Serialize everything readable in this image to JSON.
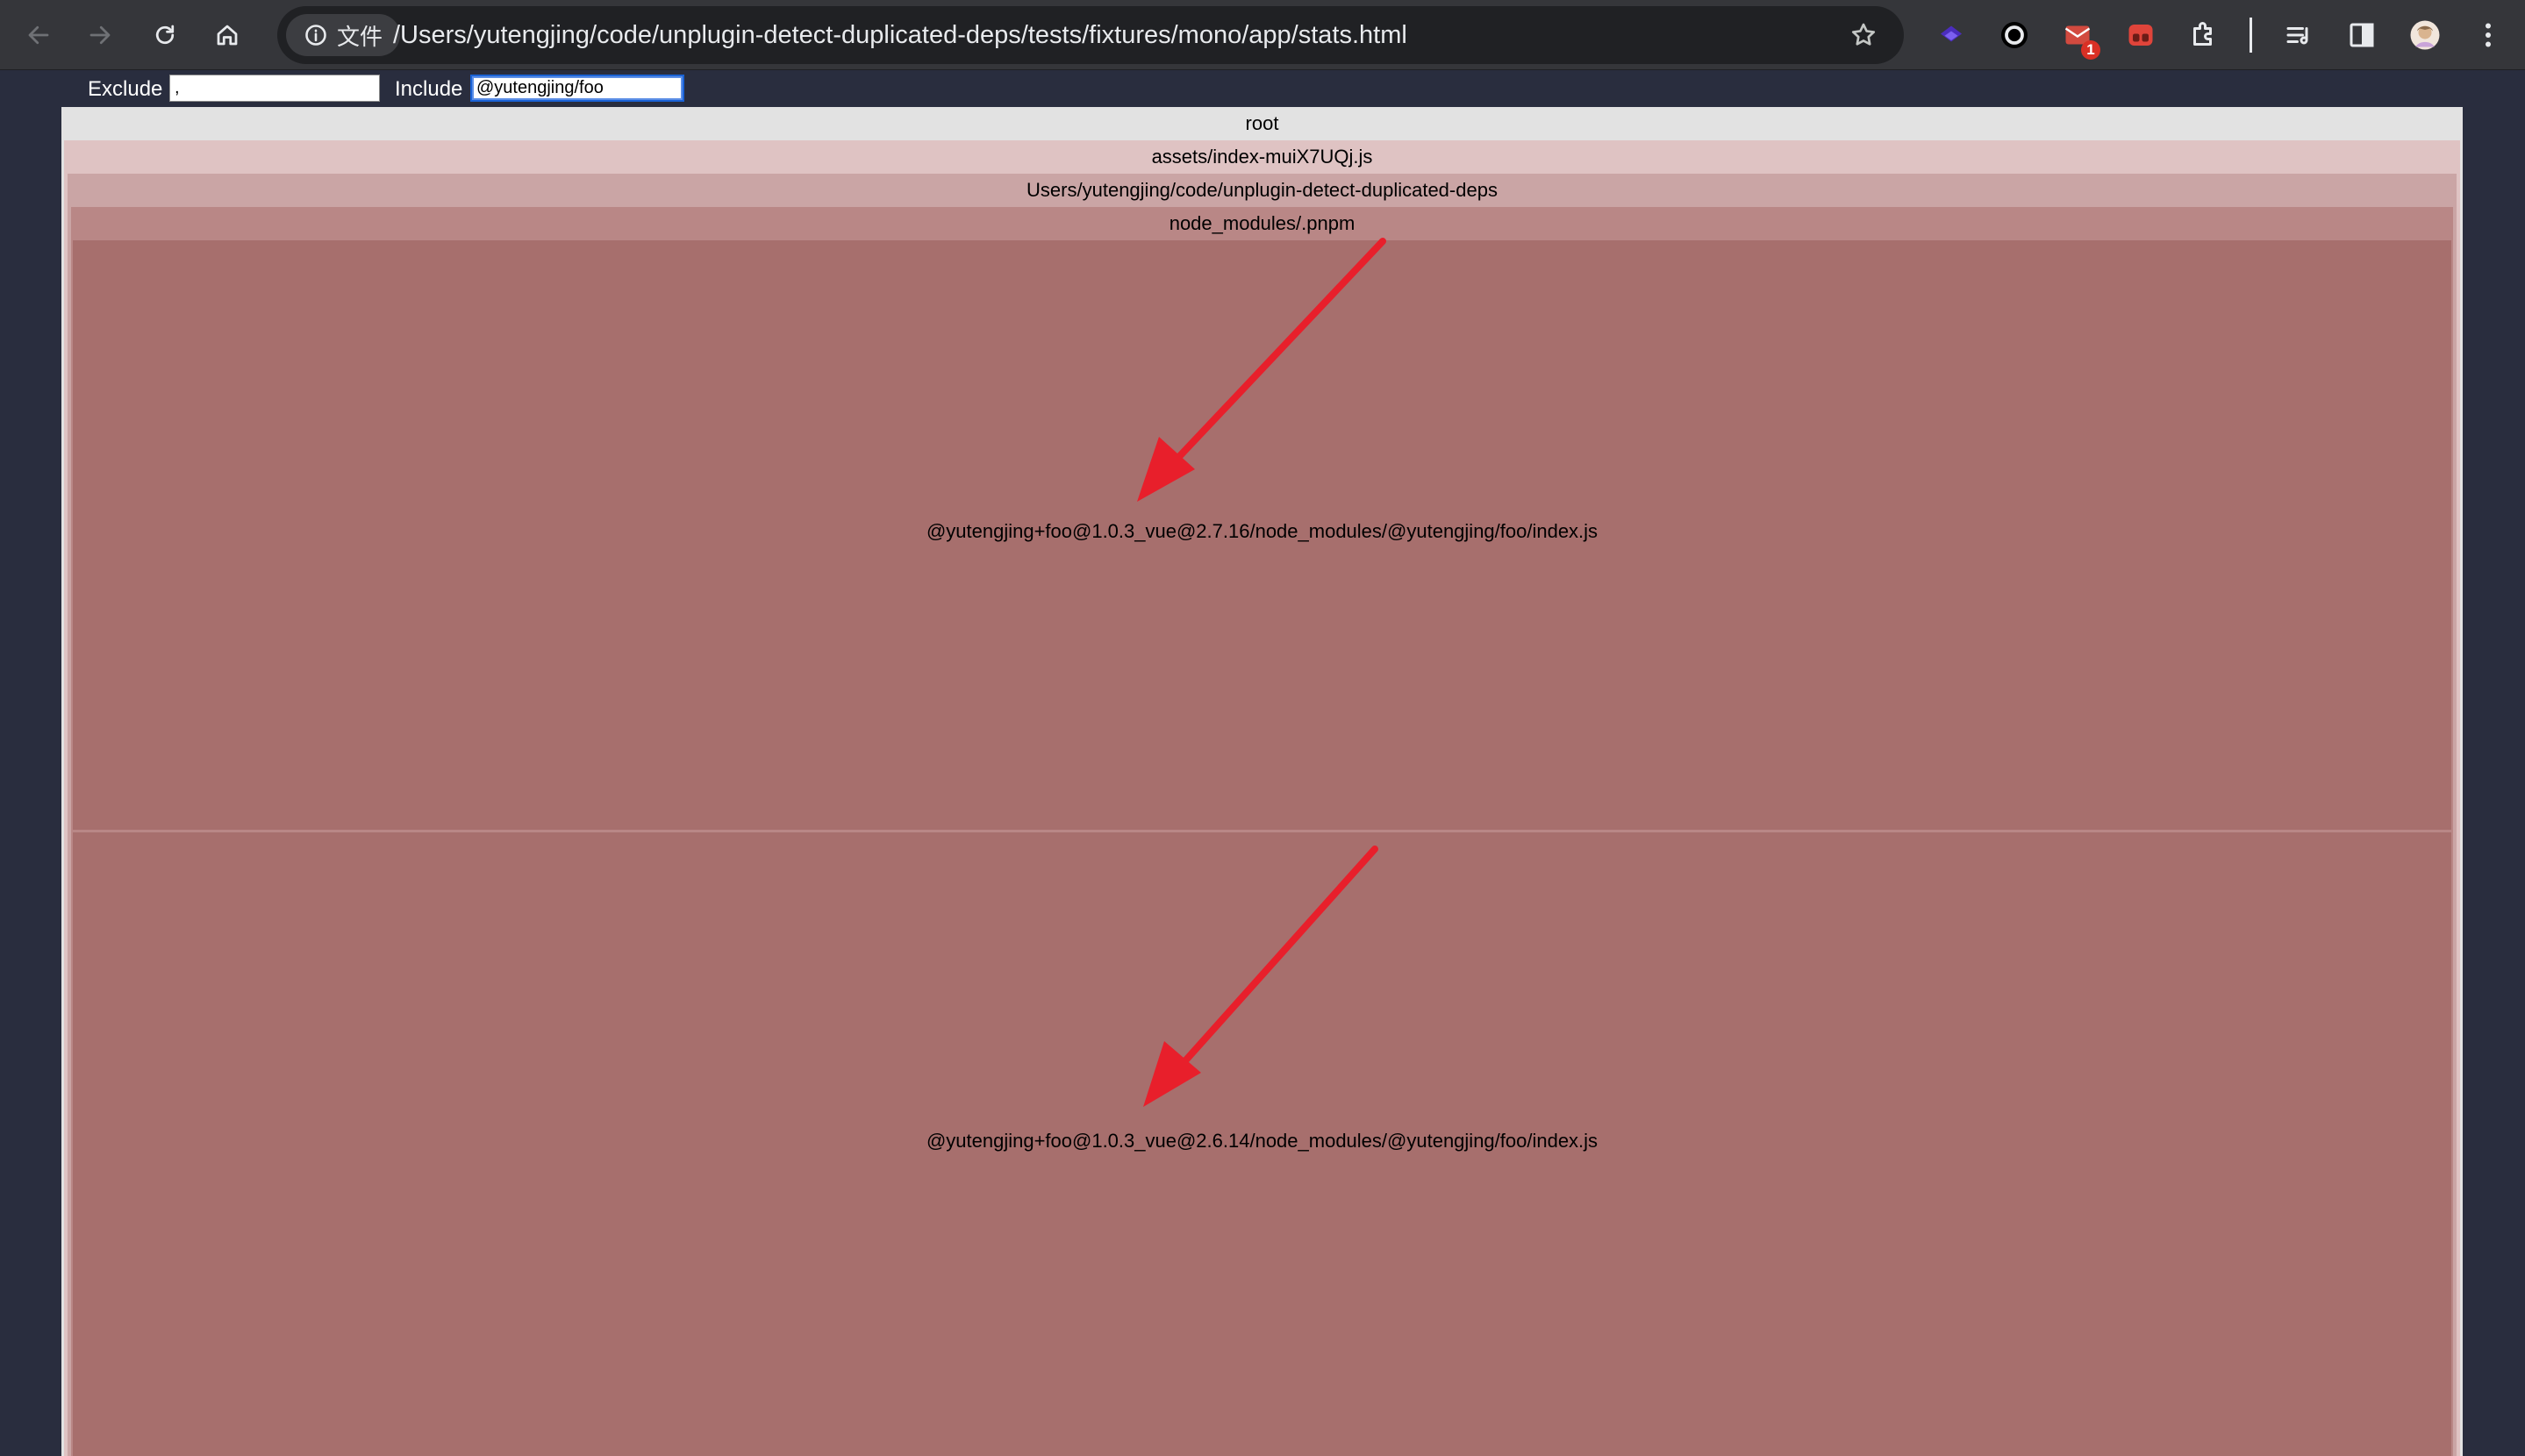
{
  "browser": {
    "chip_label": "文件",
    "url": "/Users/yutengjing/code/unplugin-detect-duplicated-deps/tests/fixtures/mono/app/stats.html",
    "mail_badge": "1",
    "icons": [
      "back-icon",
      "forward-icon",
      "reload-icon",
      "home-icon",
      "info-icon",
      "star-icon",
      "extension-icon",
      "puzzle-icon",
      "media-queue-icon",
      "side-panel-icon",
      "profile-avatar",
      "more-icon"
    ]
  },
  "filters": {
    "exclude_label": "Exclude",
    "exclude_value": ",",
    "include_label": "Include",
    "include_value": "@yutengjing/foo"
  },
  "tree": {
    "root": "root",
    "bundle": "assets/index-muiX7UQj.js",
    "project": "Users/yutengjing/code/unplugin-detect-duplicated-deps",
    "pnpm": "node_modules/.pnpm",
    "leaves": [
      "@yutengjing+foo@1.0.3_vue@2.7.16/node_modules/@yutengjing/foo/index.js",
      "@yutengjing+foo@1.0.3_vue@2.6.14/node_modules/@yutengjing/foo/index.js"
    ]
  },
  "colors": {
    "level0": "#e2e2e2",
    "level1": "#dfc3c3",
    "level2": "#caa5a5",
    "level3": "#b98786",
    "leaf": "#a76f6d",
    "annotation_arrow": "#e81f2b"
  }
}
